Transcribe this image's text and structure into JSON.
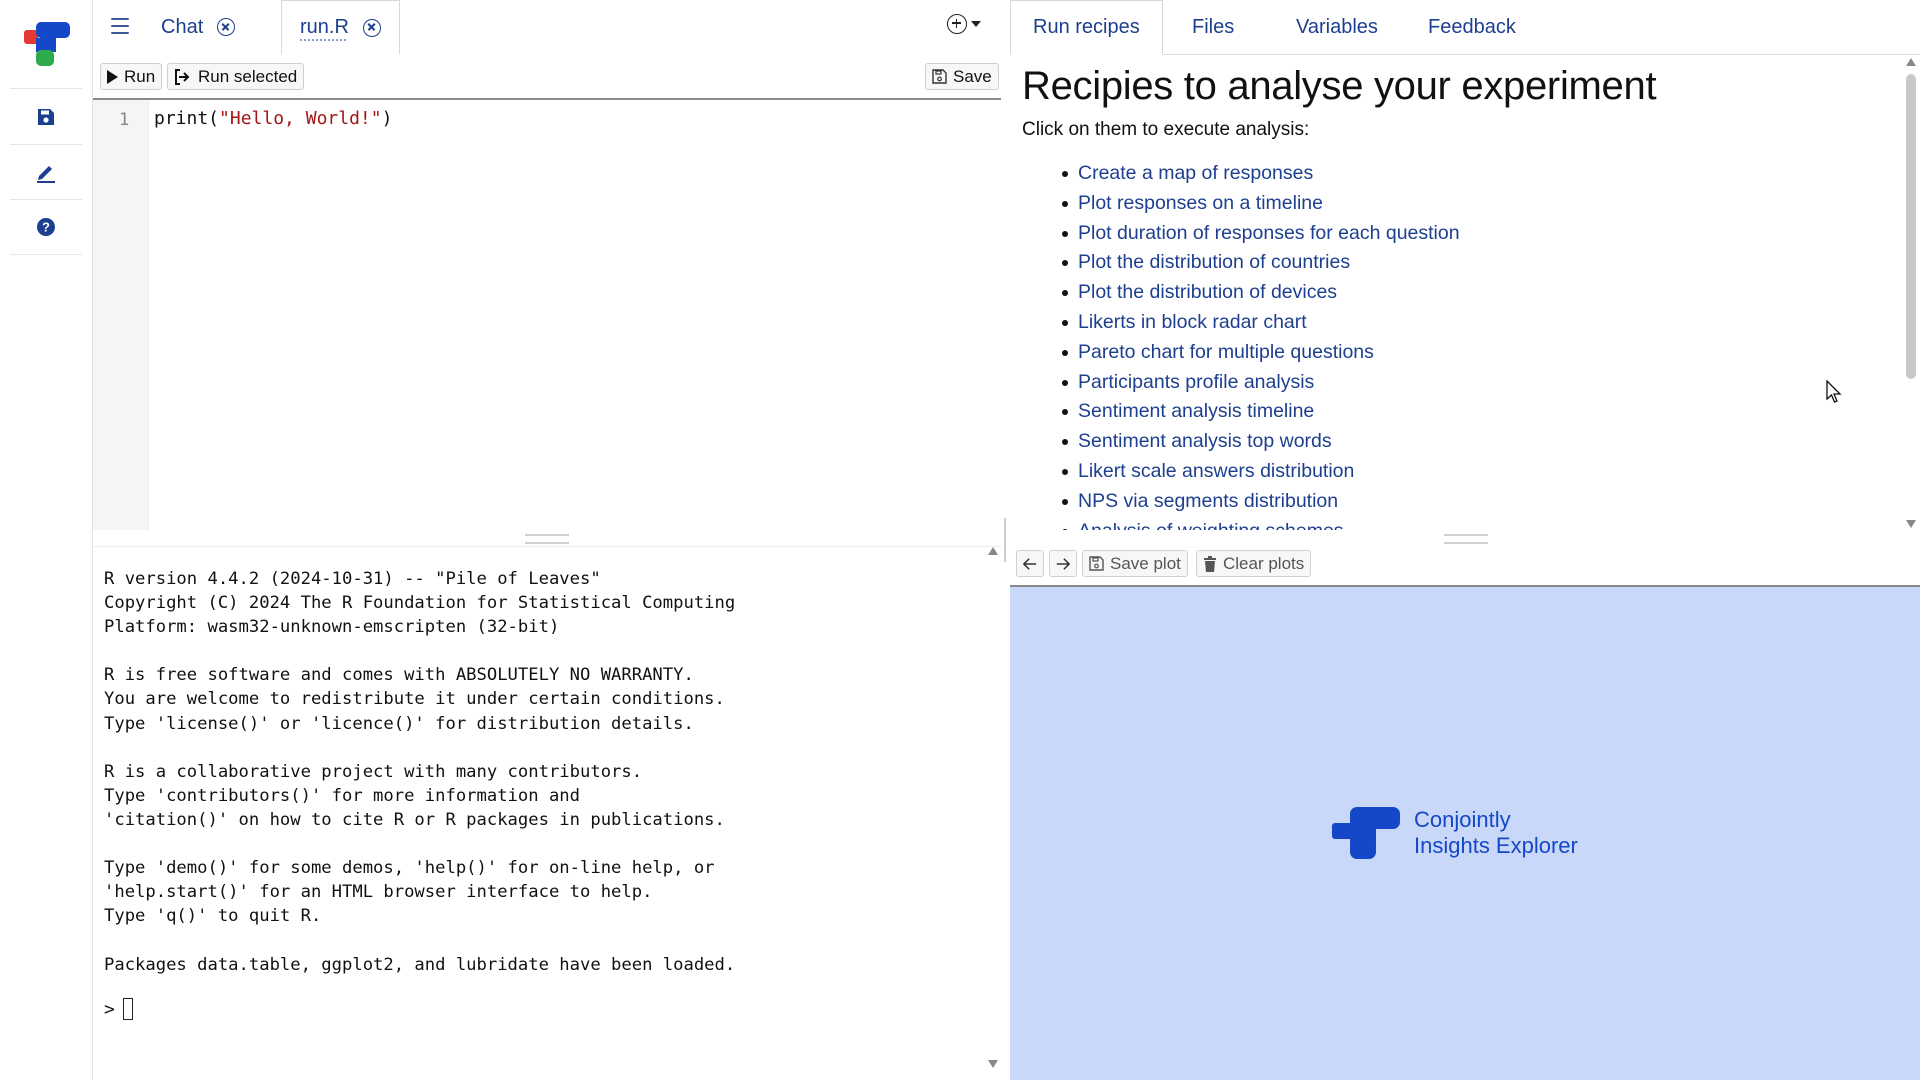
{
  "rail": {
    "items": [
      "save-icon",
      "edit-pen-icon",
      "help-icon"
    ],
    "brand_colors": [
      "#e53935",
      "#1448c8",
      "#2eaa4a"
    ]
  },
  "editor_tabs": [
    {
      "label": "Chat",
      "active": false
    },
    {
      "label": "run.R",
      "active": true
    }
  ],
  "toolbar": {
    "run_label": "Run",
    "run_selected_label": "Run selected",
    "save_label": "Save"
  },
  "editor": {
    "line_number": "1",
    "code_prefix": "print(",
    "code_string": "\"Hello, World!\"",
    "code_suffix": ")"
  },
  "console": {
    "output": "R version 4.4.2 (2024-10-31) -- \"Pile of Leaves\"\nCopyright (C) 2024 The R Foundation for Statistical Computing\nPlatform: wasm32-unknown-emscripten (32-bit)\n\nR is free software and comes with ABSOLUTELY NO WARRANTY.\nYou are welcome to redistribute it under certain conditions.\nType 'license()' or 'licence()' for distribution details.\n\nR is a collaborative project with many contributors.\nType 'contributors()' for more information and\n'citation()' on how to cite R or R packages in publications.\n\nType 'demo()' for some demos, 'help()' for on-line help, or\n'help.start()' for an HTML browser interface to help.\nType 'q()' to quit R.\n\nPackages data.table, ggplot2, and lubridate have been loaded.",
    "prompt": ">"
  },
  "right_tabs": [
    {
      "label": "Run recipes",
      "active": true
    },
    {
      "label": "Files",
      "active": false
    },
    {
      "label": "Variables",
      "active": false
    },
    {
      "label": "Feedback",
      "active": false
    }
  ],
  "recipes": {
    "title": "Recipies to analyse your experiment",
    "intro": "Click on them to execute analysis:",
    "items": [
      "Create a map of responses",
      "Plot responses on a timeline",
      "Plot duration of responses for each question",
      "Plot the distribution of countries",
      "Plot the distribution of devices",
      "Likerts in block radar chart",
      "Pareto chart for multiple questions",
      "Participants profile analysis",
      "Sentiment analysis timeline",
      "Sentiment analysis top words",
      "Likert scale answers distribution",
      "NPS via segments distribution",
      "Analysis of weighting schemes"
    ]
  },
  "plot_toolbar": {
    "save_plot_label": "Save plot",
    "clear_plots_label": "Clear plots"
  },
  "brand": {
    "line1": "Conjointly",
    "line2": "Insights Explorer",
    "color": "#1448c8"
  },
  "colors": {
    "link": "#1d3f8f",
    "plot_background": "#c9d8f9"
  }
}
